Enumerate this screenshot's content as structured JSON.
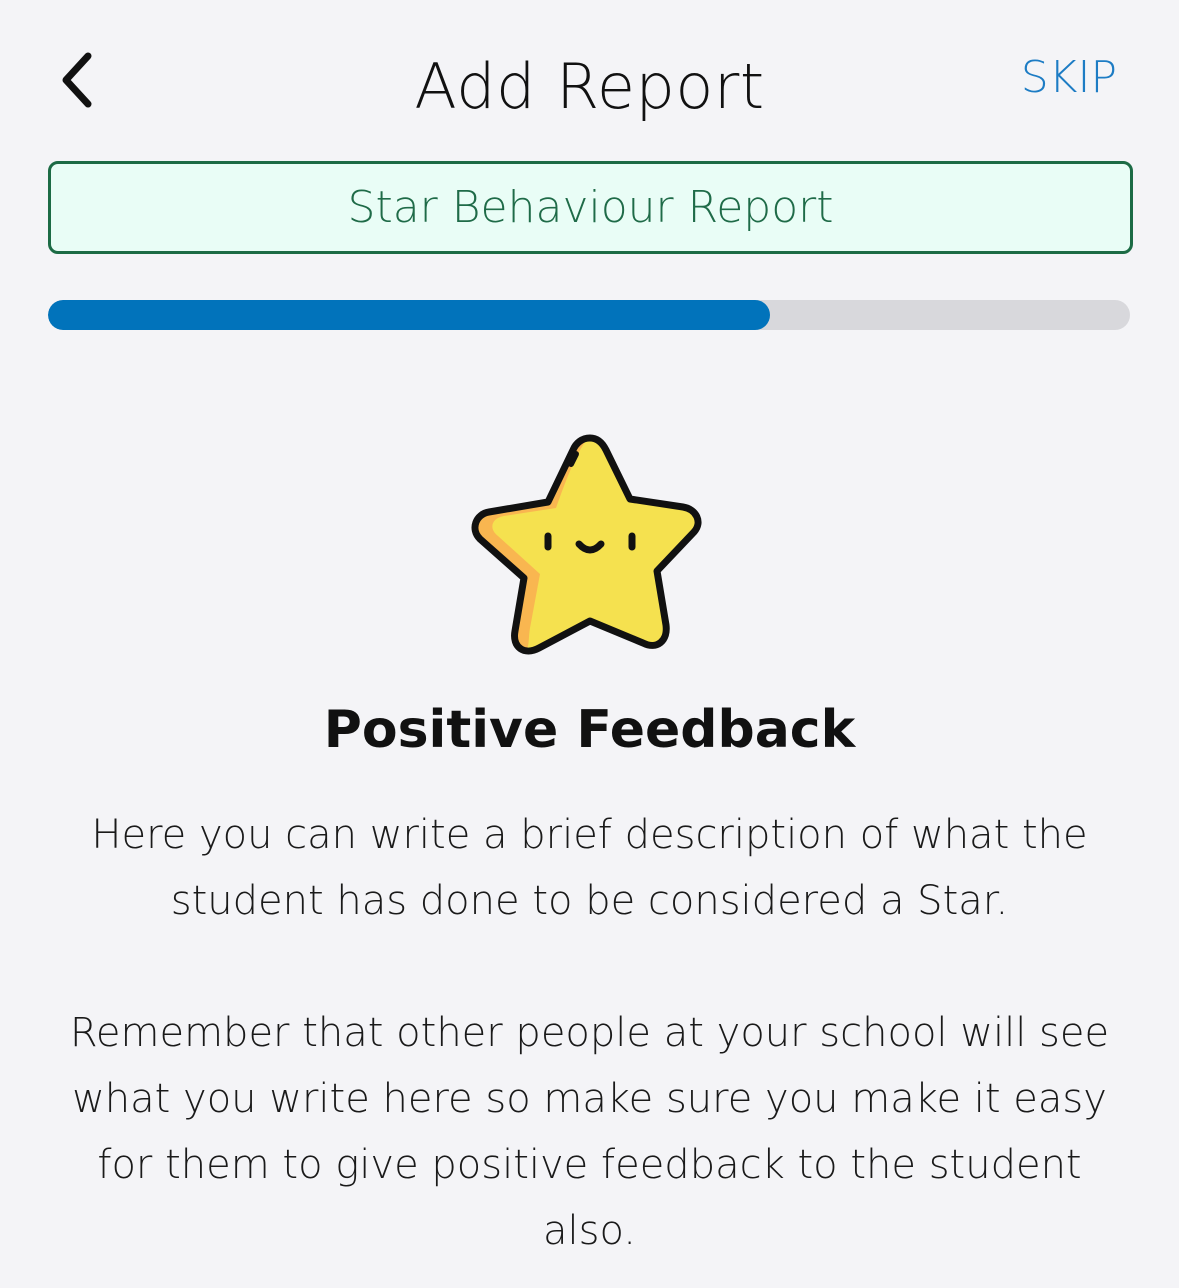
{
  "header": {
    "title": "Add Report",
    "skip_label": "SKIP",
    "back_icon": "chevron-left-icon"
  },
  "report_type": {
    "label": "Star Behaviour Report"
  },
  "progress": {
    "fraction": 0.667,
    "fill_color": "#0173bb",
    "track_color": "#d8d8dc"
  },
  "illustration": {
    "icon": "smiling-star-icon",
    "fill_color": "#f5e14f",
    "shade_color": "#f9b650"
  },
  "content": {
    "heading": "Positive Feedback",
    "paragraph_1": "Here you can write a brief description of what the student has done to be considered a Star.",
    "paragraph_2": "Remember that other people at your school will see what you write here so make sure you make it easy for them to give positive feedback to the student also."
  },
  "colors": {
    "accent": "#1d7cc4",
    "report_border": "#1c6b45",
    "report_bg": "#e9fdf6",
    "background": "#f4f4f7"
  }
}
